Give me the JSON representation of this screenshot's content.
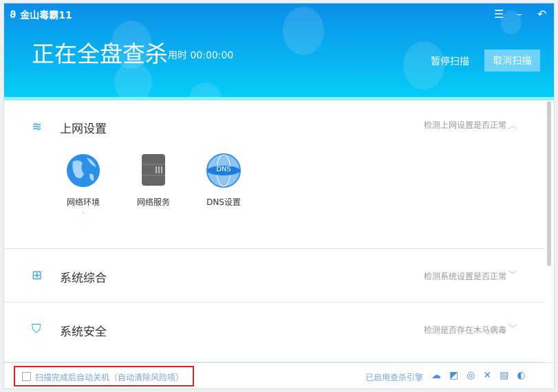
{
  "app": {
    "name": "金山毒霸11"
  },
  "header": {
    "title": "正在全盘查杀",
    "elapsed_label": "用时 00:00:00",
    "pause_label": "暂停扫描",
    "cancel_label": "取消扫描"
  },
  "sections": [
    {
      "name": "上网设置",
      "desc": "检测上网设置是否正常",
      "expanded": true,
      "items": [
        {
          "label": "网络环境"
        },
        {
          "label": "网络服务"
        },
        {
          "label": "DNS设置",
          "icon_text": "DNS"
        }
      ]
    },
    {
      "name": "系统综合",
      "desc": "检测系统设置是否正常",
      "expanded": false
    },
    {
      "name": "系统安全",
      "desc": "检测是否存在木马病毒",
      "expanded": false
    }
  ],
  "footer": {
    "auto_shutdown_label": "扫描完成后自动关机（自动清除风险项）",
    "auto_shutdown_checked": false,
    "engine_label": "已启用查杀引擎"
  },
  "colors": {
    "accent": "#0b8ee9",
    "highlight": "#e02424"
  }
}
